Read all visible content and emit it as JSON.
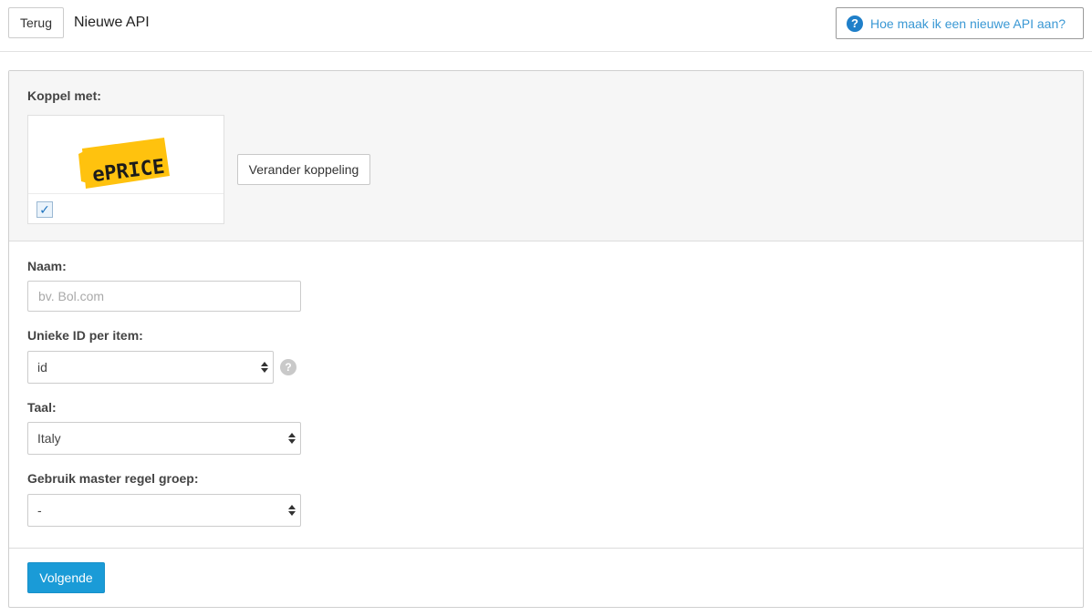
{
  "header": {
    "back_label": "Terug",
    "title": "Nieuwe API",
    "help_label": "Hoe maak ik een nieuwe API aan?"
  },
  "connection": {
    "label": "Koppel met:",
    "logo_text": "ePRICE",
    "logo_color": "#ffc20e",
    "selected": true,
    "change_label": "Verander koppeling"
  },
  "form": {
    "name": {
      "label": "Naam:",
      "placeholder": "bv. Bol.com",
      "value": ""
    },
    "unique_id": {
      "label": "Unieke ID per item:",
      "value": "id"
    },
    "language": {
      "label": "Taal:",
      "value": "Italy"
    },
    "master_group": {
      "label": "Gebruik master regel groep:",
      "value": "-"
    }
  },
  "footer": {
    "next_label": "Volgende",
    "accent": "#1a9bd7"
  }
}
